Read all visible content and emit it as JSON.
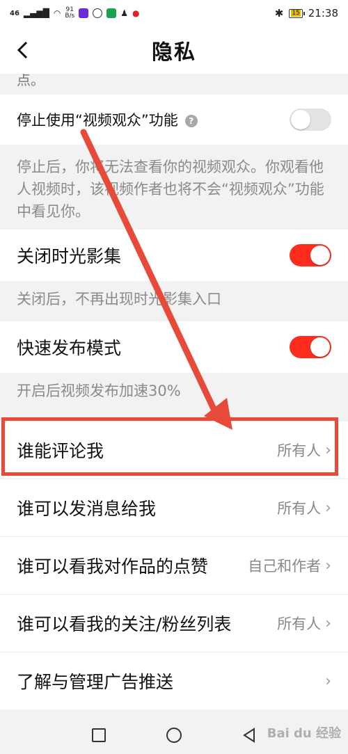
{
  "status_bar": {
    "signal": "46",
    "net_speed_value": "91",
    "net_speed_unit": "B/s",
    "battery": "15",
    "time": "21:38"
  },
  "nav": {
    "back_icon": "chevron-left-icon",
    "title": "隐私"
  },
  "partial_text": "点。",
  "items": {
    "video_viewers": {
      "label": "停止使用“视频观众”功能",
      "help_icon": "?",
      "toggle_on": false,
      "desc": "停止后，你将无法查看你的视频观众。你观看他人视频时，该视频作者也将不会“视频观众”功能中看见你。"
    },
    "time_album": {
      "label": "关闭时光影集",
      "toggle_on": true,
      "desc": "关闭后，不再出现时光影集入口"
    },
    "quick_publish": {
      "label": "快速发布模式",
      "toggle_on": true,
      "desc": "开启后视频发布加速30%"
    },
    "who_comment": {
      "label": "谁能评论我",
      "value": "所有人"
    },
    "who_message": {
      "label": "谁可以发消息给我",
      "value": "所有人"
    },
    "who_likes": {
      "label": "谁可以看我对作品的点赞",
      "value": "自己和作者"
    },
    "who_follow_list": {
      "label": "谁可以看我的关注/粉丝列表",
      "value": "所有人"
    },
    "ad_manage": {
      "label": "了解与管理广告推送",
      "value": ""
    }
  },
  "chevron": "›",
  "watermark": "Bai du 经验",
  "colors": {
    "accent_red": "#fe2c1c",
    "annotation_red": "#e84a3a"
  }
}
